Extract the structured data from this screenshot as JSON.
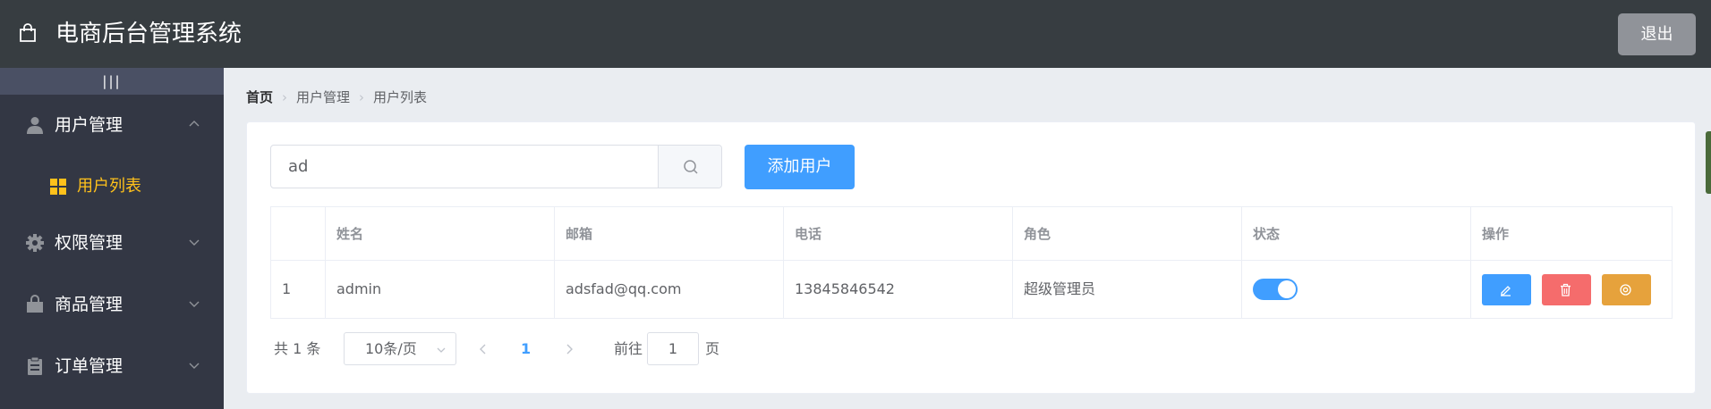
{
  "header": {
    "title": "电商后台管理系统",
    "logout_label": "退出"
  },
  "sidebar": {
    "toggle_label": "|||",
    "menus": [
      {
        "label": "用户管理",
        "icon": "user-icon",
        "expanded": true
      },
      {
        "label": "权限管理",
        "icon": "gear-icon",
        "expanded": false
      },
      {
        "label": "商品管理",
        "icon": "shopping-bag-icon",
        "expanded": false
      },
      {
        "label": "订单管理",
        "icon": "clipboard-icon",
        "expanded": false
      }
    ],
    "active_submenu": {
      "label": "用户列表",
      "icon": "grid-icon"
    }
  },
  "breadcrumb": {
    "items": [
      "首页",
      "用户管理",
      "用户列表"
    ]
  },
  "search": {
    "value": "ad"
  },
  "add_button_label": "添加用户",
  "table": {
    "headers": [
      "",
      "姓名",
      "邮箱",
      "电话",
      "角色",
      "状态",
      "操作"
    ],
    "rows": [
      {
        "index": "1",
        "name": "admin",
        "email": "adsfad@qq.com",
        "phone": "13845846542",
        "role": "超级管理员",
        "state_on": true
      }
    ]
  },
  "pagination": {
    "total_text": "共 1 条",
    "page_size": "10条/页",
    "current_page": "1",
    "goto_label": "前往",
    "goto_value": "1",
    "goto_suffix": "页"
  },
  "colors": {
    "header_bg": "#373d41",
    "sidebar_bg": "#333744",
    "active_text": "#ffc11b",
    "primary": "#409eff",
    "danger": "#f56c6c",
    "warning": "#e6a23c",
    "info": "#909399"
  }
}
